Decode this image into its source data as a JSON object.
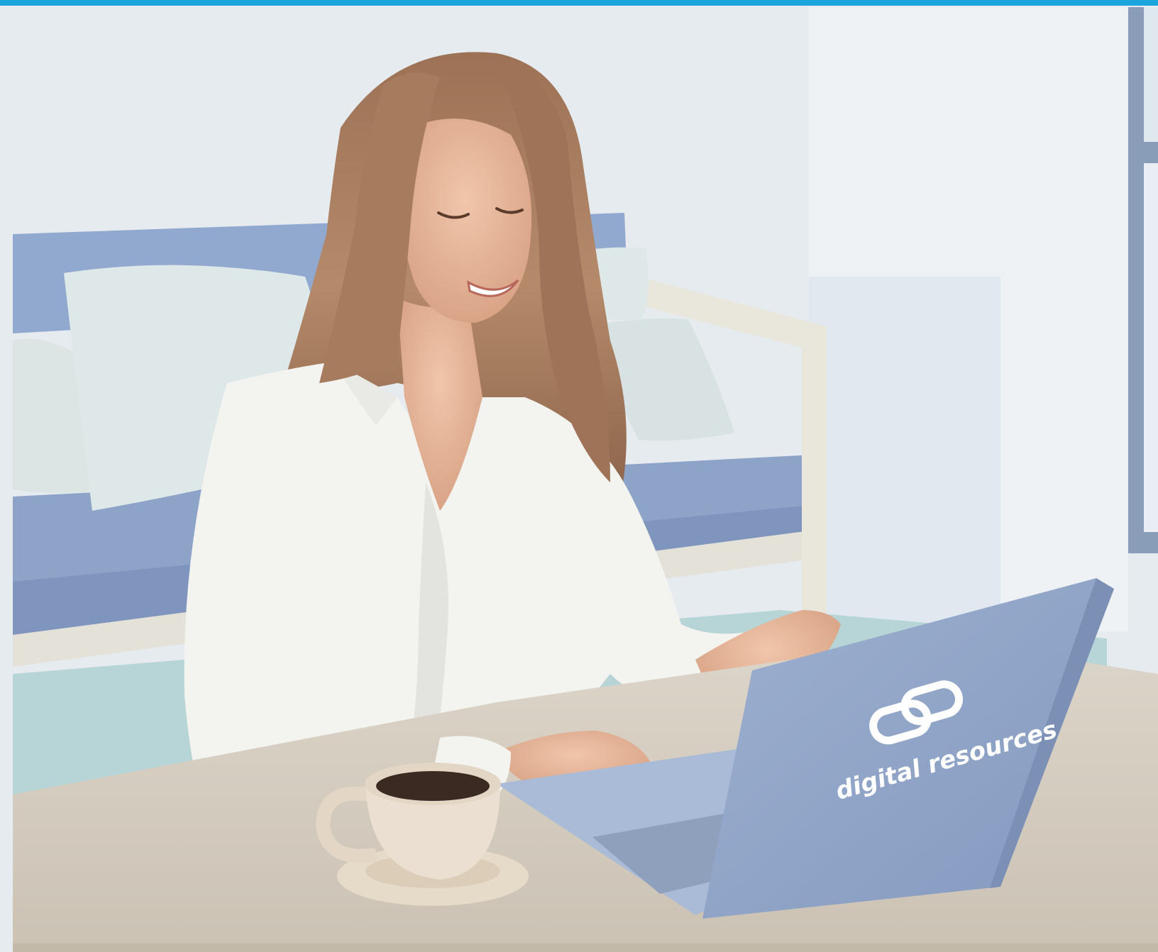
{
  "illustration": {
    "subject": "woman-using-laptop",
    "laptop_logo": {
      "text": "digital resources",
      "icon": "link-chain-icon"
    }
  },
  "colors": {
    "top_bar": "#1aa6dd",
    "wall": "#e6ebf0",
    "wall_right": "#eef2f5",
    "sofa": "#92a9cf",
    "sofa_dark": "#7f95bd",
    "pillow": "#dde6e6",
    "floor": "#b7d5d6",
    "table": "#d6cfc3",
    "laptop": "#8fa3c6",
    "laptop_base": "#a9bbd6",
    "shirt": "#f3f3f0",
    "skin": "#e8b99e",
    "hair": "#a87d60",
    "cup": "#eadfd1",
    "coffee": "#3a2a22"
  }
}
